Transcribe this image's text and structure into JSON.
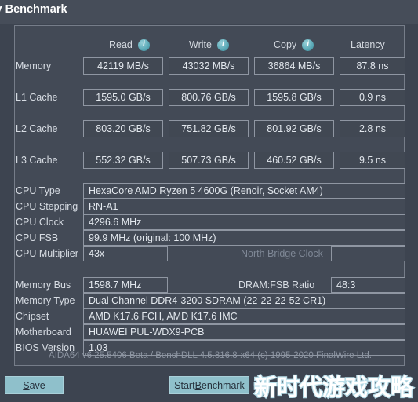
{
  "window": {
    "title": "ory Benchmark",
    "title_full": "Cache & Memory Benchmark"
  },
  "columns": {
    "read": "Read",
    "write": "Write",
    "copy": "Copy",
    "latency": "Latency",
    "info_glyph": "i",
    "info_icon_name": "info-icon"
  },
  "benchmarks": [
    {
      "label": "Memory",
      "read": "42119 MB/s",
      "write": "43032 MB/s",
      "copy": "36864 MB/s",
      "latency": "87.8 ns"
    },
    {
      "label": "L1 Cache",
      "read": "1595.0 GB/s",
      "write": "800.76 GB/s",
      "copy": "1595.8 GB/s",
      "latency": "0.9 ns"
    },
    {
      "label": "L2 Cache",
      "read": "803.20 GB/s",
      "write": "751.82 GB/s",
      "copy": "801.92 GB/s",
      "latency": "2.8 ns"
    },
    {
      "label": "L3 Cache",
      "read": "552.32 GB/s",
      "write": "507.73 GB/s",
      "copy": "460.52 GB/s",
      "latency": "9.5 ns"
    }
  ],
  "cpu_info": {
    "cpu_type_label": "CPU Type",
    "cpu_type_value": "HexaCore AMD Ryzen 5 4600G  (Renoir, Socket AM4)",
    "cpu_stepping_label": "CPU Stepping",
    "cpu_stepping_value": "RN-A1",
    "cpu_clock_label": "CPU Clock",
    "cpu_clock_value": "4296.6 MHz",
    "cpu_fsb_label": "CPU FSB",
    "cpu_fsb_value": "99.9 MHz  (original: 100 MHz)",
    "cpu_multiplier_label": "CPU Multiplier",
    "cpu_multiplier_value": "43x",
    "north_bridge_clock_label": "North Bridge Clock",
    "north_bridge_clock_value": ""
  },
  "memory_info": {
    "memory_bus_label": "Memory Bus",
    "memory_bus_value": "1598.7 MHz",
    "dram_fsb_ratio_label": "DRAM:FSB Ratio",
    "dram_fsb_ratio_value": "48:3",
    "memory_type_label": "Memory Type",
    "memory_type_value": "Dual Channel DDR4-3200 SDRAM  (22-22-22-52 CR1)",
    "chipset_label": "Chipset",
    "chipset_value": "AMD K17.6 FCH, AMD K17.6 IMC",
    "motherboard_label": "Motherboard",
    "motherboard_value": "HUAWEI PUL-WDX9-PCB",
    "bios_version_label": "BIOS Version",
    "bios_version_value": "1.03"
  },
  "credit": "AIDA64 v6.25.5406 Beta / BenchDLL 4.5.816.8-x64  (c) 1995-2020 FinalWire Ltd.",
  "buttons": {
    "save_prefix": "",
    "save_accel": "S",
    "save_suffix": "ave",
    "start_prefix": "Start ",
    "start_accel": "B",
    "start_suffix": "enchmark"
  },
  "watermark": {
    "text": "新时代游戏攻略"
  },
  "colors": {
    "window_bg": "#3d4450",
    "titlebar_bg": "#464d59",
    "panel_bg": "#434a56",
    "panel_border": "#767d89",
    "field_border": "#8f96a2",
    "text": "#d8dde4",
    "dim_text": "#7f8896",
    "accent_button": "#8fc0cb",
    "info_icon": "#56a6b4",
    "watermark_outline": "#b9dde8"
  }
}
